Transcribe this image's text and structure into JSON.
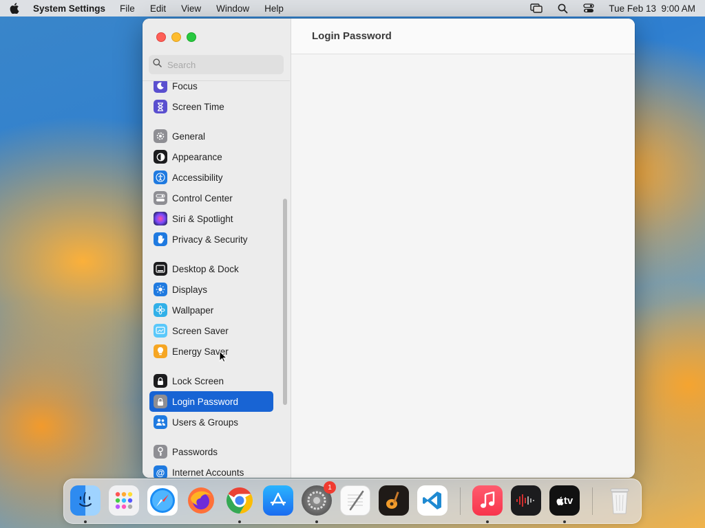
{
  "menubar": {
    "app_name": "System Settings",
    "menus": [
      "File",
      "Edit",
      "View",
      "Window",
      "Help"
    ],
    "clock": "Tue Feb 13  9:00 AM",
    "status_icons": [
      "screen-mirroring-icon",
      "spotlight-search-icon",
      "control-center-icon"
    ]
  },
  "window": {
    "title": "Login Password",
    "search": {
      "placeholder": "Search",
      "value": ""
    },
    "sidebar": {
      "items": [
        {
          "label": "Focus",
          "icon": "moon-icon",
          "color": "#5a4fcf"
        },
        {
          "label": "Screen Time",
          "icon": "hourglass-icon",
          "color": "#5a4fcf"
        },
        {
          "label": "General",
          "icon": "gear-icon",
          "color": "#8e8e93"
        },
        {
          "label": "Appearance",
          "icon": "appearance-icon",
          "color": "#1c1c1e"
        },
        {
          "label": "Accessibility",
          "icon": "accessibility-icon",
          "color": "#1f7ae0"
        },
        {
          "label": "Control Center",
          "icon": "control-center-icon",
          "color": "#8e8e93"
        },
        {
          "label": "Siri & Spotlight",
          "icon": "siri-icon",
          "color": "#3a3aa6"
        },
        {
          "label": "Privacy & Security",
          "icon": "hand-icon",
          "color": "#1f7ae0"
        },
        {
          "label": "Desktop & Dock",
          "icon": "desktop-dock-icon",
          "color": "#1c1c1e"
        },
        {
          "label": "Displays",
          "icon": "sun-icon",
          "color": "#1f7ae0"
        },
        {
          "label": "Wallpaper",
          "icon": "flower-icon",
          "color": "#31b0e8"
        },
        {
          "label": "Screen Saver",
          "icon": "screen-saver-icon",
          "color": "#5ac8fa"
        },
        {
          "label": "Energy Saver",
          "icon": "lightbulb-icon",
          "color": "#f6a623"
        },
        {
          "label": "Lock Screen",
          "icon": "lock-icon",
          "color": "#1c1c1e"
        },
        {
          "label": "Login Password",
          "icon": "lock-icon",
          "color": "#8e8e93",
          "selected": true
        },
        {
          "label": "Users & Groups",
          "icon": "users-icon",
          "color": "#1f7ae0"
        },
        {
          "label": "Passwords",
          "icon": "key-icon",
          "color": "#8e8e93"
        },
        {
          "label": "Internet Accounts",
          "icon": "at-icon",
          "color": "#1f7ae0"
        }
      ]
    }
  },
  "dock": {
    "apps": [
      {
        "name": "Finder",
        "icon": "finder-icon",
        "running": true
      },
      {
        "name": "Launchpad",
        "icon": "launchpad-icon",
        "running": false
      },
      {
        "name": "Safari",
        "icon": "safari-icon",
        "running": false
      },
      {
        "name": "Firefox",
        "icon": "firefox-icon",
        "running": false
      },
      {
        "name": "Chrome",
        "icon": "chrome-icon",
        "running": true
      },
      {
        "name": "App Store",
        "icon": "app-store-icon",
        "running": false
      },
      {
        "name": "System Settings",
        "icon": "system-settings-icon",
        "running": true,
        "badge": "1"
      },
      {
        "name": "TextEdit",
        "icon": "textedit-icon",
        "running": false
      },
      {
        "name": "GarageBand",
        "icon": "garageband-icon",
        "running": false
      },
      {
        "name": "Visual Studio Code",
        "icon": "vscode-icon",
        "running": false
      },
      {
        "name": "Music",
        "icon": "music-icon",
        "running": true
      },
      {
        "name": "Voice Memos",
        "icon": "voice-memos-icon",
        "running": false
      },
      {
        "name": "Apple TV",
        "icon": "apple-tv-icon",
        "running": true,
        "label": "tv"
      },
      {
        "name": "Trash",
        "icon": "trash-icon",
        "running": false
      }
    ]
  }
}
